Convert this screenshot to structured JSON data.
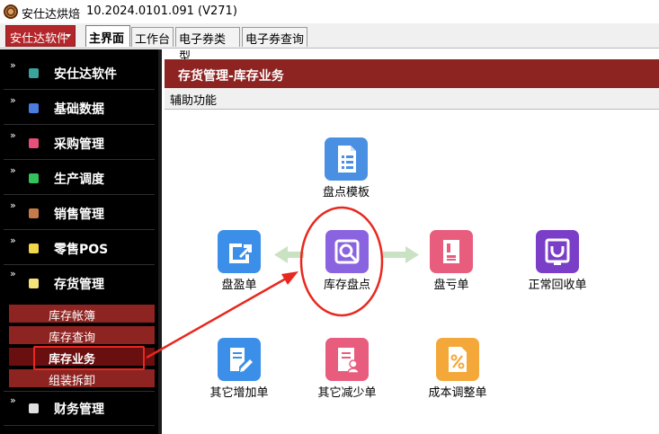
{
  "window": {
    "app_name": "安仕达烘焙",
    "version": "10.2024.0101.091 (V271)"
  },
  "tabbar": {
    "app_menu_label": "安仕达软件",
    "tabs": [
      {
        "label": "主界面",
        "active": true
      },
      {
        "label": "工作台",
        "active": false
      },
      {
        "label": "电子券类型",
        "active": false
      },
      {
        "label": "电子券查询",
        "active": false
      }
    ]
  },
  "sidebar": {
    "items": [
      {
        "label": "安仕达软件",
        "icon": "teal-cube-icon",
        "color": "#3aa39a"
      },
      {
        "label": "基础数据",
        "icon": "blue-cube-icon",
        "color": "#4a7de0"
      },
      {
        "label": "采购管理",
        "icon": "pink-cube-icon",
        "color": "#e8507a"
      },
      {
        "label": "生产调度",
        "icon": "green-cube-icon",
        "color": "#34c25a"
      },
      {
        "label": "销售管理",
        "icon": "brown-cube-icon",
        "color": "#c77b4a"
      },
      {
        "label": "零售POS",
        "icon": "yellow-cube-icon",
        "color": "#f0d84a"
      },
      {
        "label": "存货管理",
        "icon": "yellow-cube-icon",
        "color": "#f4e27a"
      },
      {
        "label": "财务管理",
        "icon": "white-cube-icon",
        "color": "#e0e0e0"
      }
    ],
    "sub_items": [
      {
        "label": "库存帐簿",
        "active": false
      },
      {
        "label": "库存查询",
        "active": false
      },
      {
        "label": "库存业务",
        "active": true
      },
      {
        "label": "组装拆卸",
        "active": false
      }
    ]
  },
  "content": {
    "header_title": "存货管理-库存业务",
    "aux_label": "辅助功能",
    "functions": {
      "template": {
        "label": "盘点模板",
        "color": "#4a90e2"
      },
      "surplus": {
        "label": "盘盈单",
        "color": "#3b8fe8"
      },
      "stocktake": {
        "label": "库存盘点",
        "color": "#8a63e0"
      },
      "loss": {
        "label": "盘亏单",
        "color": "#e85d7e"
      },
      "recycle": {
        "label": "正常回收单",
        "color": "#7b3ec8"
      },
      "other_add": {
        "label": "其它增加单",
        "color": "#3b8fe8"
      },
      "other_reduce": {
        "label": "其它减少单",
        "color": "#e85d7e"
      },
      "cost_adjust": {
        "label": "成本调整单",
        "color": "#f5a83a"
      }
    }
  },
  "colors": {
    "accent_red": "#8e2422",
    "annotation_red": "#e8281e",
    "flow_arrow": "#c9e3c2"
  }
}
